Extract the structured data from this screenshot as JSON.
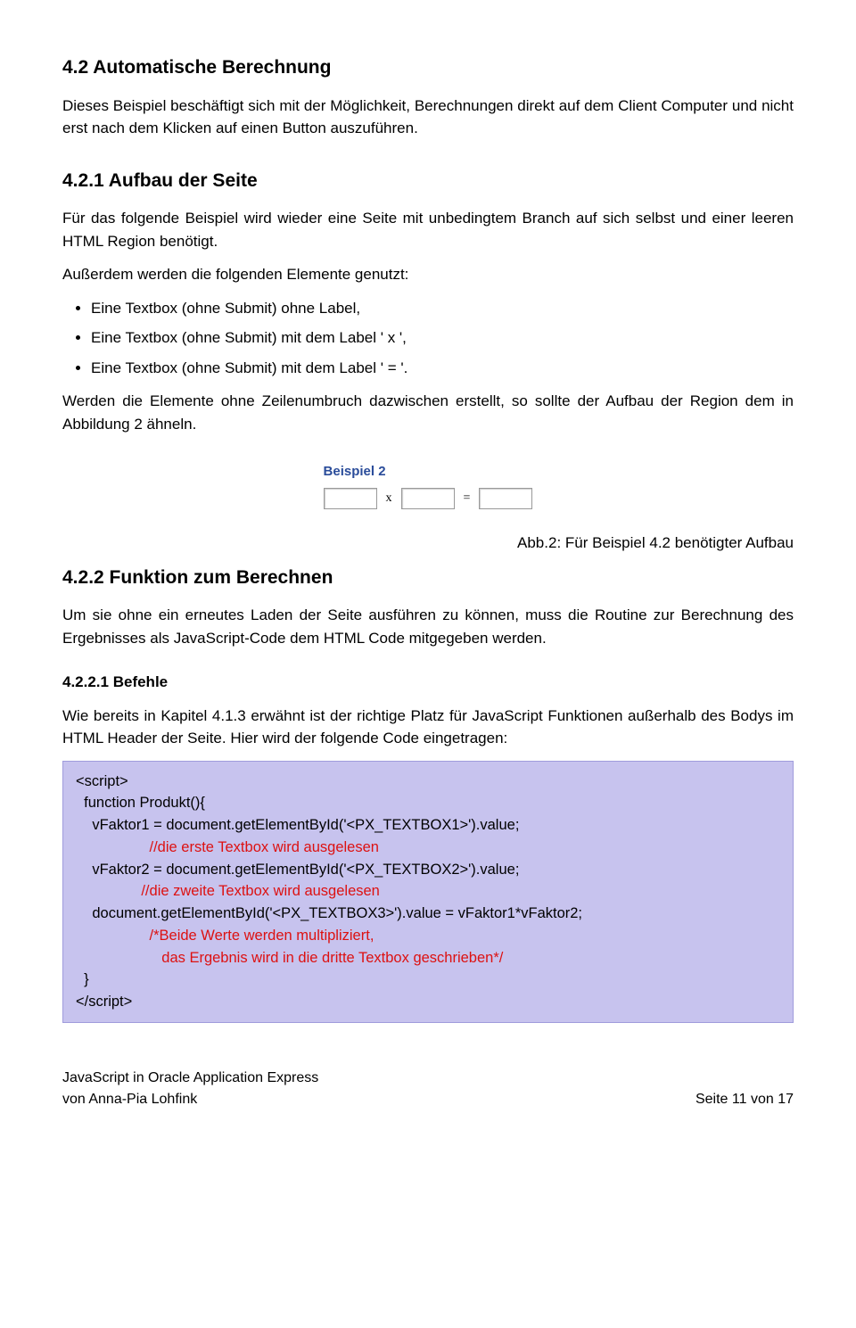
{
  "section_4_2": {
    "heading": "4.2 Automatische Berechnung",
    "p1": "Dieses Beispiel beschäftigt sich mit der Möglichkeit,  Berechnungen direkt auf dem Client Computer und nicht erst nach dem Klicken auf einen Button auszuführen."
  },
  "section_4_2_1": {
    "heading": "4.2.1 Aufbau der Seite",
    "p1": "Für das folgende Beispiel wird wieder eine Seite mit unbedingtem Branch auf sich selbst und einer leeren HTML Region benötigt.",
    "p2": "Außerdem werden die folgenden Elemente genutzt:",
    "bullets": [
      "Eine Textbox (ohne Submit) ohne Label,",
      "Eine Textbox (ohne Submit) mit dem Label ' x ',",
      "Eine Textbox (ohne Submit) mit dem Label ' = '."
    ],
    "p3": "Werden die Elemente ohne Zeilenumbruch dazwischen erstellt, so sollte der Aufbau der Region dem in Abbildung 2 ähneln."
  },
  "figure": {
    "title": "Beispiel 2",
    "op1": "x",
    "op2": "=",
    "caption": "Abb.2: Für Beispiel 4.2 benötigter Aufbau"
  },
  "section_4_2_2": {
    "heading": "4.2.2 Funktion zum Berechnen",
    "p1": "Um sie ohne ein erneutes Laden der Seite ausführen zu können, muss die Routine zur Berechnung des Ergebnisses als JavaScript-Code dem HTML Code mitgegeben werden."
  },
  "section_4_2_2_1": {
    "heading": "4.2.2.1 Befehle",
    "p1": "Wie bereits in Kapitel 4.1.3 erwähnt ist der richtige Platz für JavaScript Funktionen außerhalb des Bodys im HTML Header der Seite. Hier wird der folgende Code eingetragen:"
  },
  "code": {
    "l1": "<script>",
    "l2": "  function Produkt(){",
    "l3": "    vFaktor1 = document.getElementById('<PX_TEXTBOX1>').value;",
    "c1": "                  //die erste Textbox wird ausgelesen",
    "l4": "    vFaktor2 = document.getElementById('<PX_TEXTBOX2>').value;",
    "c2": "                //die zweite Textbox wird ausgelesen",
    "l5": "    document.getElementById('<PX_TEXTBOX3>').value = vFaktor1*vFaktor2;",
    "c3a": "                  /*Beide Werte werden multipliziert,",
    "c3b": "                     das Ergebnis wird in die dritte Textbox geschrieben*/",
    "l6": "  }",
    "l7": "</script>"
  },
  "footer": {
    "left1": "JavaScript in Oracle Application Express",
    "left2": "von Anna-Pia Lohfink",
    "right": "Seite 11 von 17"
  }
}
